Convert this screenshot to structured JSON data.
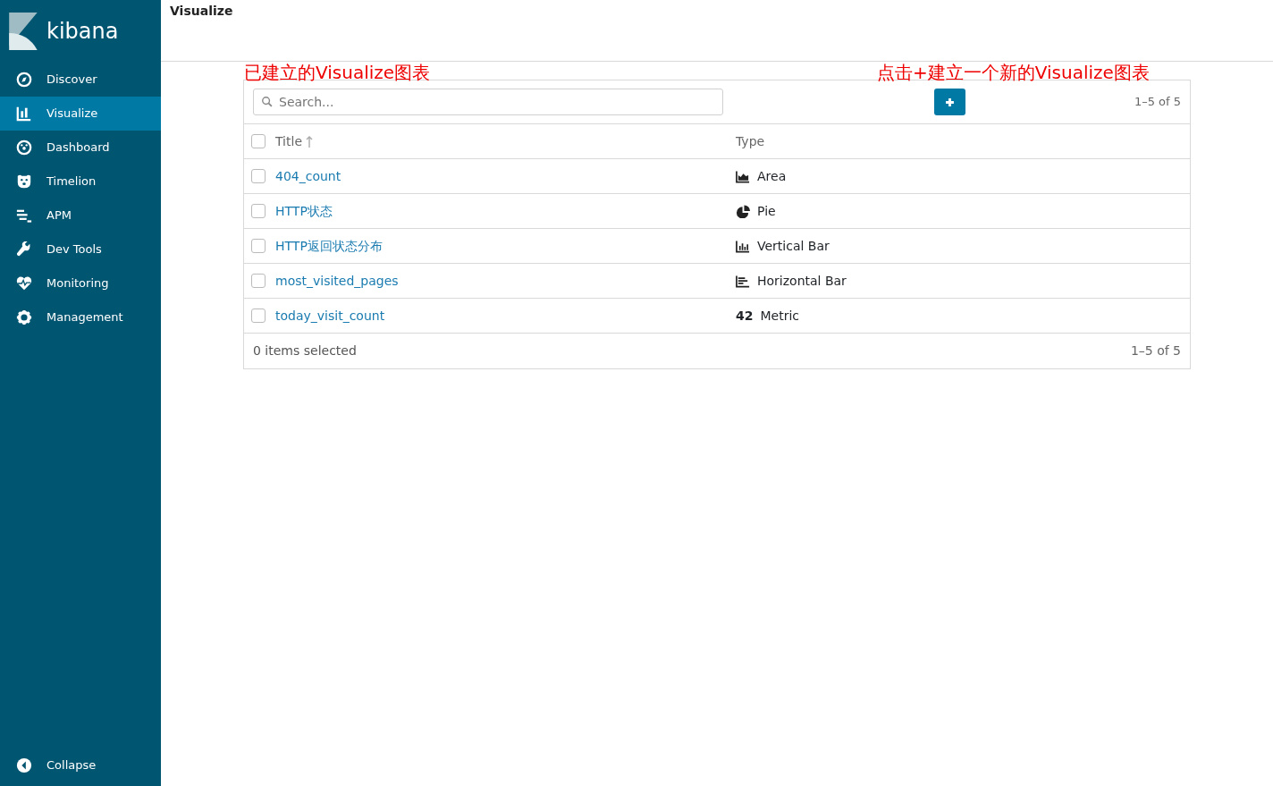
{
  "sidebar": {
    "logo": "kibana",
    "items": [
      {
        "label": "Discover",
        "kind": "compass",
        "selected": false
      },
      {
        "label": "Visualize",
        "kind": "barchart",
        "selected": true
      },
      {
        "label": "Dashboard",
        "kind": "dashboard",
        "selected": false
      },
      {
        "label": "Timelion",
        "kind": "bear",
        "selected": false
      },
      {
        "label": "APM",
        "kind": "apm",
        "selected": false
      },
      {
        "label": "Dev Tools",
        "kind": "wrench",
        "selected": false
      },
      {
        "label": "Monitoring",
        "kind": "heart",
        "selected": false
      },
      {
        "label": "Management",
        "kind": "gear",
        "selected": false
      }
    ],
    "collapse": "Collapse"
  },
  "header": {
    "title": "Visualize"
  },
  "annotations": [
    "已建立的Visualize图表",
    "点击+建立一个新的Visualize图表"
  ],
  "toolbar": {
    "search_placeholder": "Search...",
    "pagination": "1–5 of 5"
  },
  "table": {
    "select_all_checked": false,
    "columns": [
      "Title",
      "Type"
    ],
    "rows": [
      {
        "title": "404_count",
        "type": "Area",
        "kind": "area",
        "checked": false
      },
      {
        "title": "HTTP状态",
        "type": "Pie",
        "kind": "pie",
        "checked": false
      },
      {
        "title": "HTTP返回状态分布",
        "type": "Vertical Bar",
        "kind": "vertical_bar",
        "checked": false
      },
      {
        "title": "most_visited_pages",
        "type": "Horizontal Bar",
        "kind": "horizontal_bar",
        "checked": false
      },
      {
        "title": "today_visit_count",
        "type": "Metric",
        "kind": "metric",
        "icon_text": "42",
        "checked": false
      }
    ]
  },
  "footer": {
    "selected_count": "0 items selected",
    "pagination": "1–5 of 5"
  }
}
